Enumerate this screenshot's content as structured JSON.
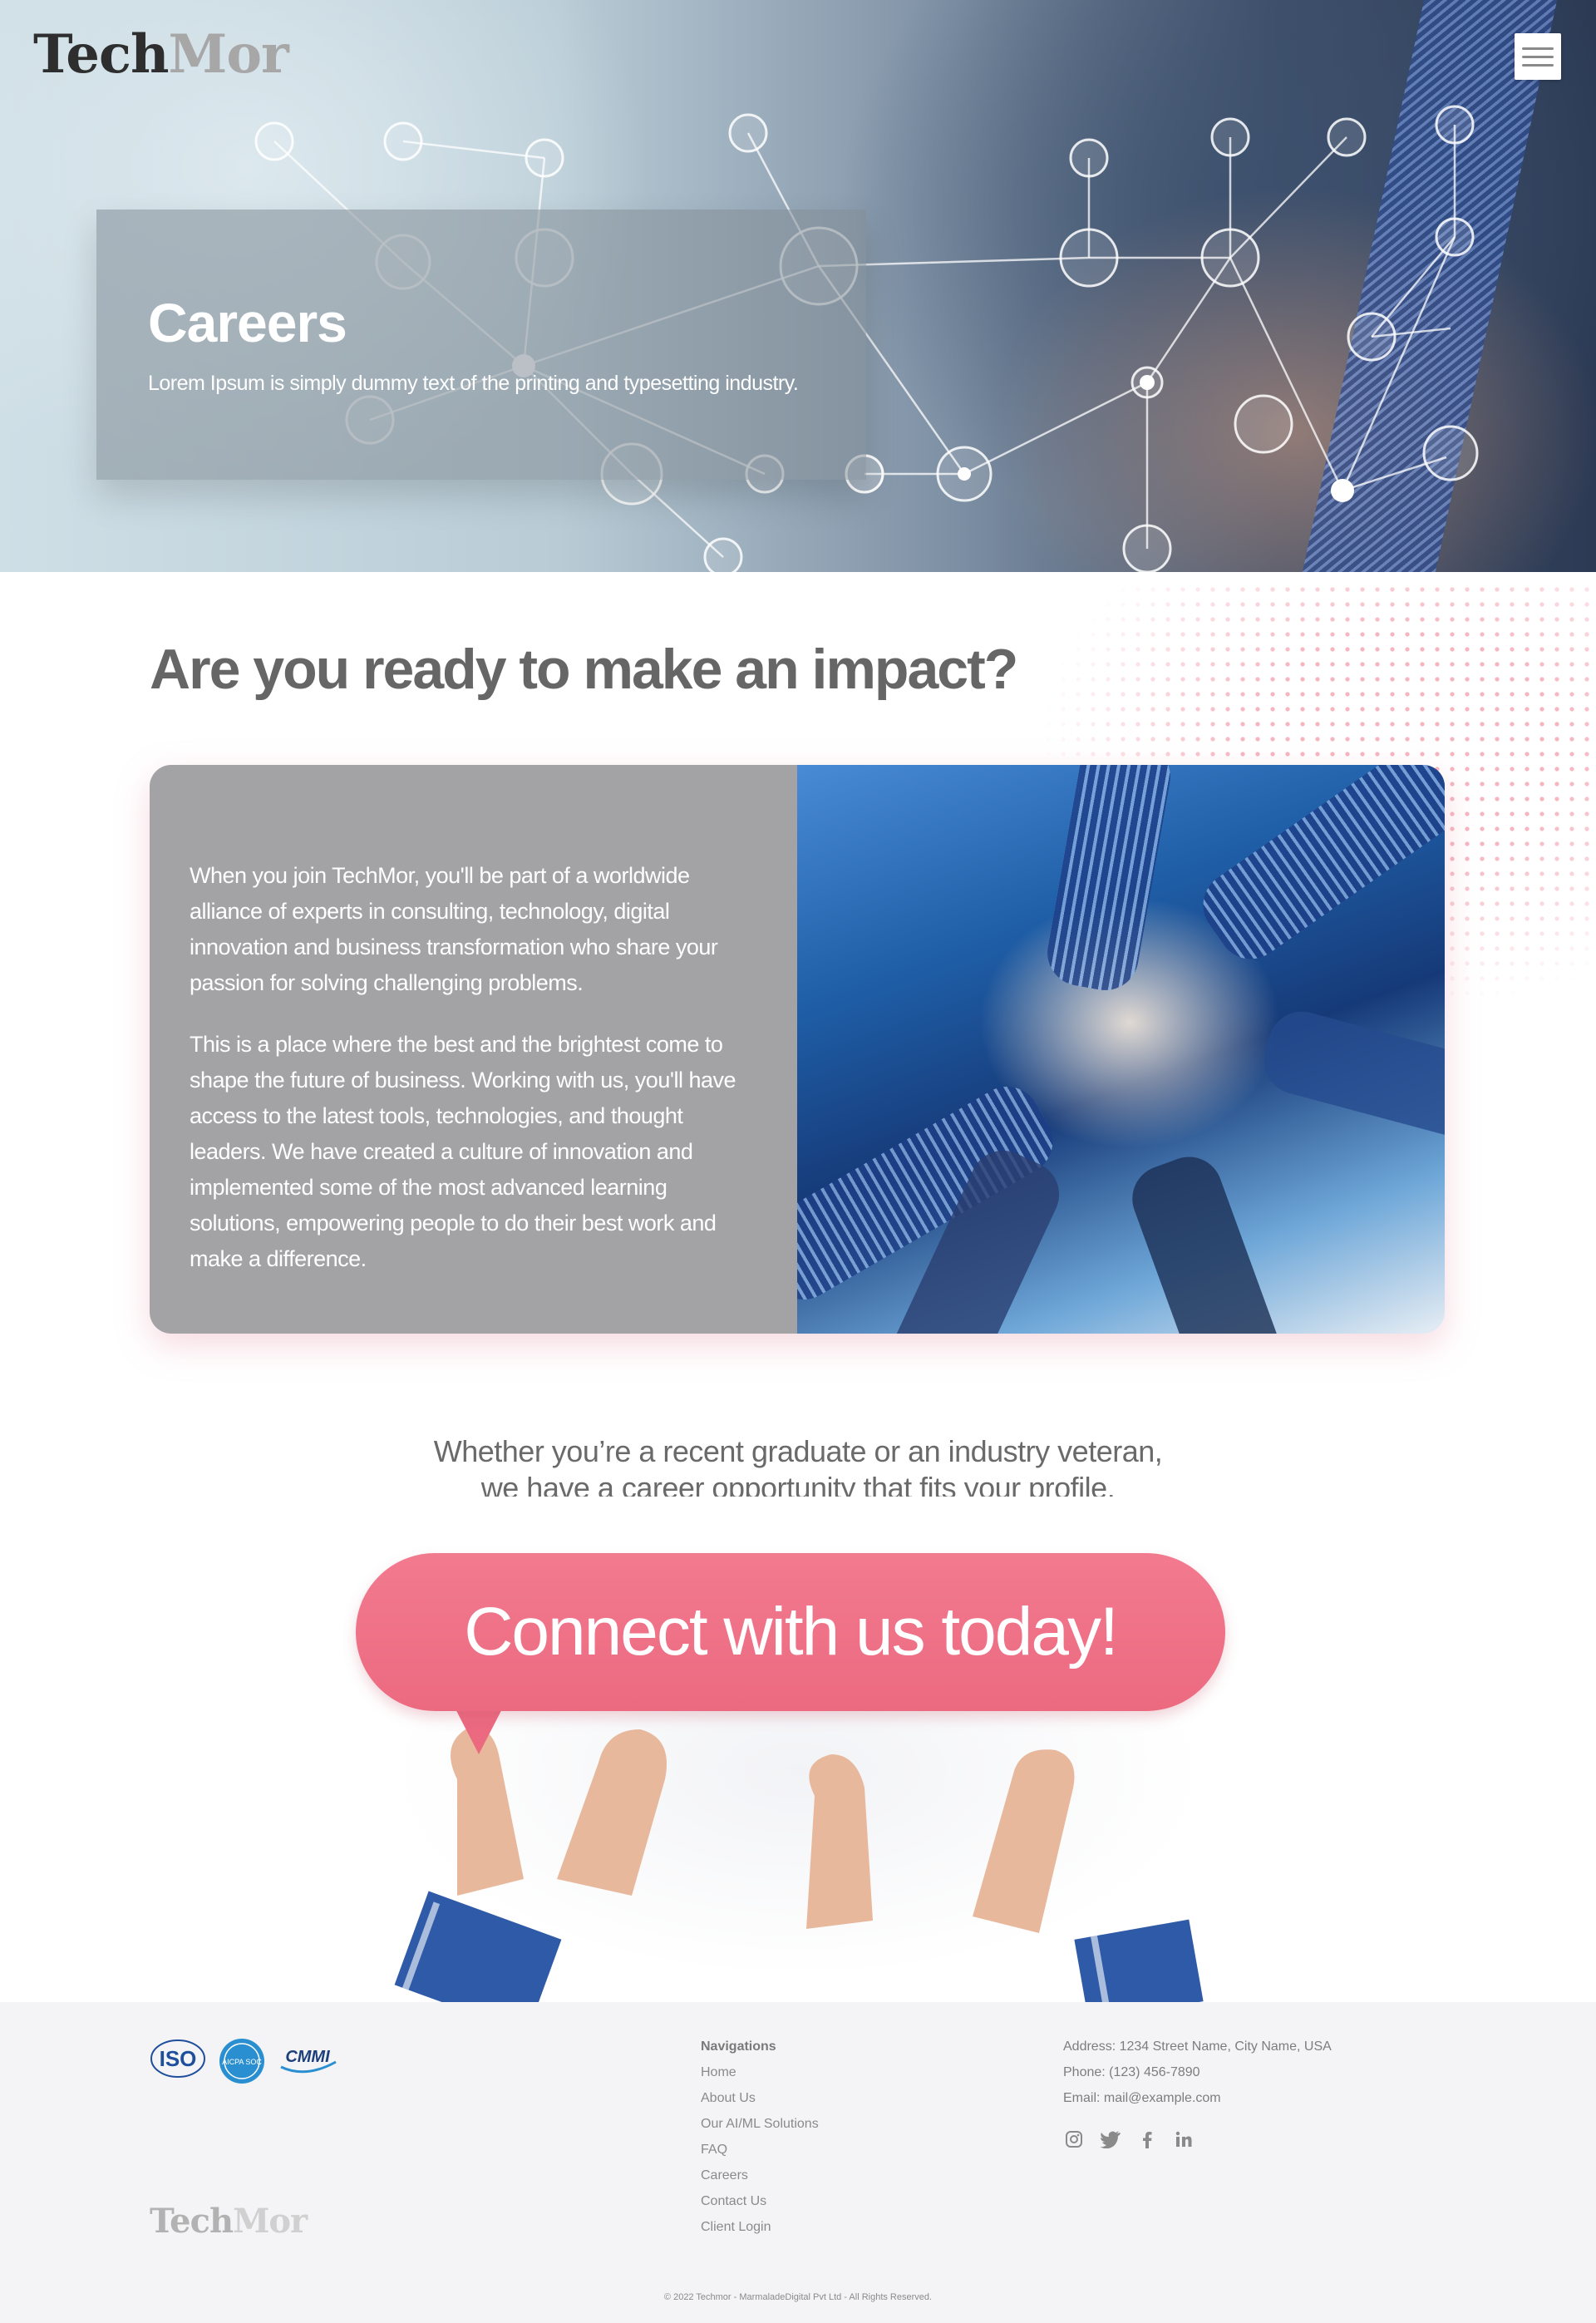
{
  "brand": {
    "name_part1": "Tech",
    "name_part2": "Mor"
  },
  "header": {
    "menu_icon": "hamburger-menu-icon"
  },
  "hero": {
    "title": "Careers",
    "subtitle": "Lorem Ipsum is simply dummy text of the printing and typesetting industry."
  },
  "impact": {
    "heading": "Are you ready to make an impact?",
    "paragraph1": "When you join TechMor, you'll be part of a worldwide alliance of experts in consulting, technology, digital innovation and business transformation who share your passion for solving challenging problems.",
    "paragraph2": "This is a place where the best and the brightest come to shape the future of business. Working with us, you'll have access to the latest tools, technologies, and thought leaders. We have created a culture of innovation and implemented some of the most advanced learning solutions, empowering people to do their best work and make a difference."
  },
  "cta": {
    "line1": "Whether you’re a recent graduate or an industry veteran,",
    "line2": "we have a career opportunity that fits your profile.",
    "button_label": "Connect with us today!"
  },
  "footer": {
    "certifications": [
      "ISO",
      "AICPA SOC",
      "CMMI"
    ],
    "nav_title": "Navigations",
    "nav_links": [
      "Home",
      "About Us",
      "Our AI/ML Solutions",
      "FAQ",
      "Careers",
      "Contact Us",
      "Client Login"
    ],
    "address": "Address: 1234 Street Name, City Name, USA",
    "phone": "Phone: (123) 456-7890",
    "email": "Email: mail@example.com",
    "social_icons": [
      "instagram-icon",
      "twitter-icon",
      "facebook-icon",
      "linkedin-icon"
    ],
    "copyright": "© 2022 Techmor - MarmaladeDigital Pvt Ltd - All Rights Reserved."
  },
  "colors": {
    "accent_pink": "#ec6a80",
    "card_gray": "#a3a3a5",
    "footer_bg": "#f4f4f6",
    "heading_gray": "#666666"
  }
}
